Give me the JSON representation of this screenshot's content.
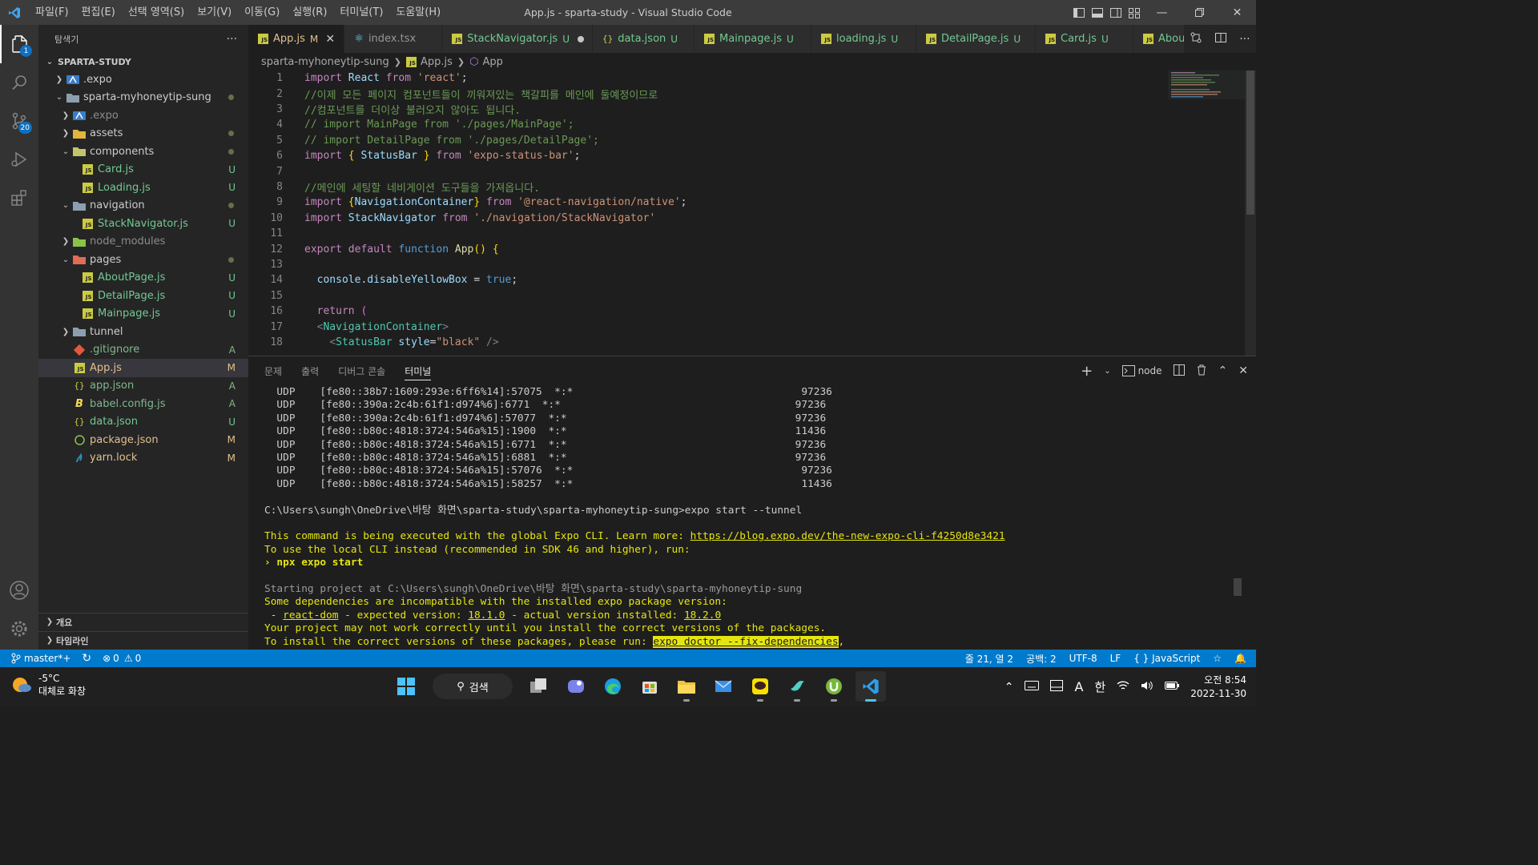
{
  "window": {
    "title": "App.js - sparta-study - Visual Studio Code",
    "menu": [
      "파일(F)",
      "편집(E)",
      "선택 영역(S)",
      "보기(V)",
      "이동(G)",
      "실행(R)",
      "터미널(T)",
      "도움말(H)"
    ]
  },
  "activity": {
    "explorer_badge": "1",
    "scm_badge": "20"
  },
  "sidebar": {
    "header": "탐색기",
    "more": "···",
    "root": "SPARTA-STUDY",
    "items": [
      {
        "label": ".expo",
        "status": ""
      },
      {
        "label": "sparta-myhoneytip-sung",
        "status": ""
      },
      {
        "label": ".expo",
        "status": ""
      },
      {
        "label": "assets",
        "status": ""
      },
      {
        "label": "components",
        "status": ""
      },
      {
        "label": "Card.js",
        "status": "U"
      },
      {
        "label": "Loading.js",
        "status": "U"
      },
      {
        "label": "navigation",
        "status": ""
      },
      {
        "label": "StackNavigator.js",
        "status": "U"
      },
      {
        "label": "node_modules",
        "status": ""
      },
      {
        "label": "pages",
        "status": ""
      },
      {
        "label": "AboutPage.js",
        "status": "U"
      },
      {
        "label": "DetailPage.js",
        "status": "U"
      },
      {
        "label": "Mainpage.js",
        "status": "U"
      },
      {
        "label": "tunnel",
        "status": ""
      },
      {
        "label": ".gitignore",
        "status": "A"
      },
      {
        "label": "App.js",
        "status": "M"
      },
      {
        "label": "app.json",
        "status": "A"
      },
      {
        "label": "babel.config.js",
        "status": "A"
      },
      {
        "label": "data.json",
        "status": "U"
      },
      {
        "label": "package.json",
        "status": "M"
      },
      {
        "label": "yarn.lock",
        "status": "M"
      }
    ],
    "outline": "개요",
    "timeline": "타임라인"
  },
  "tabs": [
    {
      "label": "App.js",
      "mark": "M"
    },
    {
      "label": "index.tsx",
      "mark": ""
    },
    {
      "label": "StackNavigator.js",
      "mark": "U"
    },
    {
      "label": "data.json",
      "mark": "U"
    },
    {
      "label": "Mainpage.js",
      "mark": "U"
    },
    {
      "label": "loading.js",
      "mark": "U"
    },
    {
      "label": "DetailPage.js",
      "mark": "U"
    },
    {
      "label": "Card.js",
      "mark": "U"
    },
    {
      "label": "About",
      "mark": ""
    }
  ],
  "breadcrumb": [
    "sparta-myhoneytip-sung",
    "App.js",
    "App"
  ],
  "editor": {
    "line_numbers": [
      "1",
      "2",
      "3",
      "4",
      "5",
      "6",
      "7",
      "8",
      "9",
      "10",
      "11",
      "12",
      "13",
      "14",
      "15",
      "16",
      "17",
      "18"
    ],
    "l2": "//이제 모든 페이지 컴포넌트들이 끼워져있는 책갈피를 메인에 둘예정이므로",
    "l3": "//컴포넌트를 더이상 불러오지 않아도 됩니다.",
    "l4": "// import MainPage from './pages/MainPage';",
    "l5": "// import DetailPage from './pages/DetailPage';",
    "l8": "//메인에 세팅할 네비게이션 도구들을 가져옵니다."
  },
  "panel": {
    "tabs": [
      "문제",
      "출력",
      "디버그 콘솔",
      "터미널"
    ],
    "shell": "node",
    "netstat": [
      {
        "proto": "UDP",
        "addr": "[fe80::38b7:1609:293e:6ff6%14]:57075",
        "remote": "*:*",
        "pid": "97236"
      },
      {
        "proto": "UDP",
        "addr": "[fe80::390a:2c4b:61f1:d974%6]:6771",
        "remote": "*:*",
        "pid": "97236"
      },
      {
        "proto": "UDP",
        "addr": "[fe80::390a:2c4b:61f1:d974%6]:57077",
        "remote": "*:*",
        "pid": "97236"
      },
      {
        "proto": "UDP",
        "addr": "[fe80::b80c:4818:3724:546a%15]:1900",
        "remote": "*:*",
        "pid": "11436"
      },
      {
        "proto": "UDP",
        "addr": "[fe80::b80c:4818:3724:546a%15]:6771",
        "remote": "*:*",
        "pid": "97236"
      },
      {
        "proto": "UDP",
        "addr": "[fe80::b80c:4818:3724:546a%15]:6881",
        "remote": "*:*",
        "pid": "97236"
      },
      {
        "proto": "UDP",
        "addr": "[fe80::b80c:4818:3724:546a%15]:57076",
        "remote": "*:*",
        "pid": "97236"
      },
      {
        "proto": "UDP",
        "addr": "[fe80::b80c:4818:3724:546a%15]:58257",
        "remote": "*:*",
        "pid": "11436"
      }
    ],
    "prompt": "C:\\Users\\sungh\\OneDrive\\바탕 화면\\sparta-study\\sparta-myhoneytip-sung>expo start --tunnel",
    "msg1": "This command is being executed with the global Expo CLI. Learn more: ",
    "msg1_link": "https://blog.expo.dev/the-new-expo-cli-f4250d8e3421",
    "msg2": "To use the local CLI instead (recommended in SDK 46 and higher), run:",
    "msg3": "› npx expo start",
    "msg4": "Starting project at C:\\Users\\sungh\\OneDrive\\바탕 화면\\sparta-study\\sparta-myhoneytip-sung",
    "msg5": "Some dependencies are incompatible with the installed expo package version:",
    "msg6_prefix": " - ",
    "msg6_pkg": "react-dom",
    "msg6_mid": " - expected version: ",
    "msg6_expected": "18.1.0",
    "msg6_mid2": " - actual version installed: ",
    "msg6_actual": "18.2.0",
    "msg7": "Your project may not work correctly until you install the correct versions of the packages.",
    "msg8": "To install the correct versions of these packages, please run: ",
    "msg8_cmd": "expo doctor --fix-dependencies",
    "msg8_tail": ","
  },
  "statusbar": {
    "branch": "master*+",
    "errors": "0",
    "warnings": "0",
    "position": "줄 21, 열 2",
    "spaces": "공백: 2",
    "encoding": "UTF-8",
    "eol": "LF",
    "language": "JavaScript"
  },
  "taskbar": {
    "temp": "-5°C",
    "weather": "대체로 화창",
    "search": "검색",
    "time": "오전 8:54",
    "date": "2022-11-30",
    "ime": "한",
    "ime_mode": "A"
  },
  "colors": {
    "accent": "#007acc",
    "untracked": "#73c991",
    "modified": "#e2c08d",
    "added": "#81b88b",
    "terminal_yellow": "#e5e510"
  }
}
